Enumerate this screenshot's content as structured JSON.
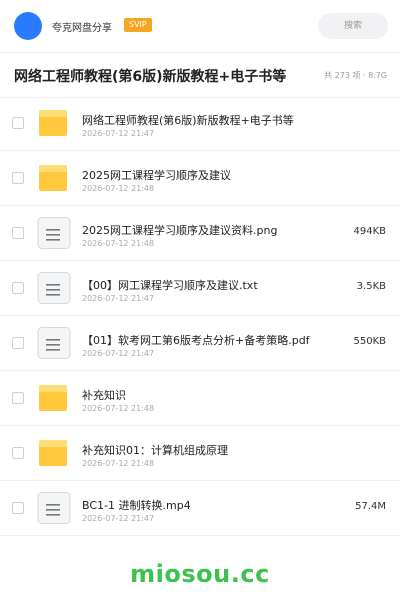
{
  "header": {
    "brand": "夸克网盘分享",
    "badge": "SVIP",
    "search_label": "搜索"
  },
  "folder": {
    "title": "网络工程师教程(第6版)新版教程+电子书等",
    "meta": "共 273 项 · 8.7G"
  },
  "files": [
    {
      "name": "网络工程师教程(第6版)新版教程+电子书等",
      "time": "2026-07-12 21:47",
      "size": "",
      "type": "folder"
    },
    {
      "name": "2025网工课程学习顺序及建议",
      "time": "2026-07-12 21:48",
      "size": "",
      "type": "folder"
    },
    {
      "name": "2025网工课程学习顺序及建议资料.png",
      "time": "2026-07-12 21:48",
      "size": "494KB",
      "type": "file"
    },
    {
      "name": "【00】网工课程学习顺序及建议.txt",
      "time": "2026-07-12 21:47",
      "size": "3.5KB",
      "type": "file"
    },
    {
      "name": "【01】软考网工第6版考点分析+备考策略.pdf",
      "time": "2026-07-12 21:47",
      "size": "550KB",
      "type": "file"
    },
    {
      "name": "补充知识",
      "time": "2026-07-12 21:48",
      "size": "",
      "type": "folder"
    },
    {
      "name": "补充知识01：计算机组成原理",
      "time": "2026-07-12 21:48",
      "size": "",
      "type": "folder"
    },
    {
      "name": "BC1-1 进制转换.mp4",
      "time": "2026-07-12 21:47",
      "size": "57.4M",
      "type": "file"
    }
  ],
  "watermark": "miosou.cc",
  "colors": {
    "avatar": "#2b7bff",
    "badge": "#f5a623",
    "folder": "#ffc83d",
    "watermark": "#3cc24d"
  },
  "icons": {
    "folder": "folder-icon",
    "file": "document-icon",
    "checkbox": "checkbox"
  }
}
